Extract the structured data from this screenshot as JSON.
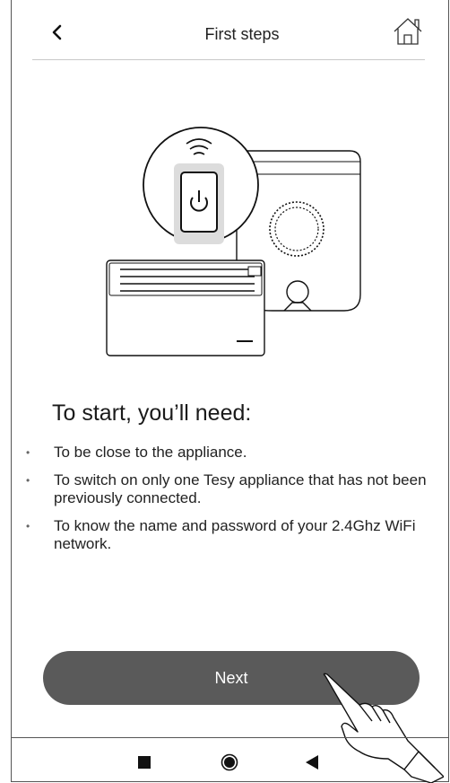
{
  "header": {
    "title": "First steps",
    "back_icon": "chevron-left-icon",
    "home_icon": "home-icon"
  },
  "content": {
    "heading": "To start, you’ll need:",
    "items": [
      "To be close to the appliance.",
      "To switch on only one Tesy appliance that has not been previously connected.",
      "To know the name and password of your 2.4Ghz WiFi network."
    ]
  },
  "next_button": {
    "label": "Next"
  },
  "nav_bar": {
    "icons": [
      "recent-apps-icon",
      "home-circle-icon",
      "back-triangle-icon"
    ]
  },
  "colors": {
    "button": "#5a5a5a",
    "text": "#1a1a1a"
  }
}
